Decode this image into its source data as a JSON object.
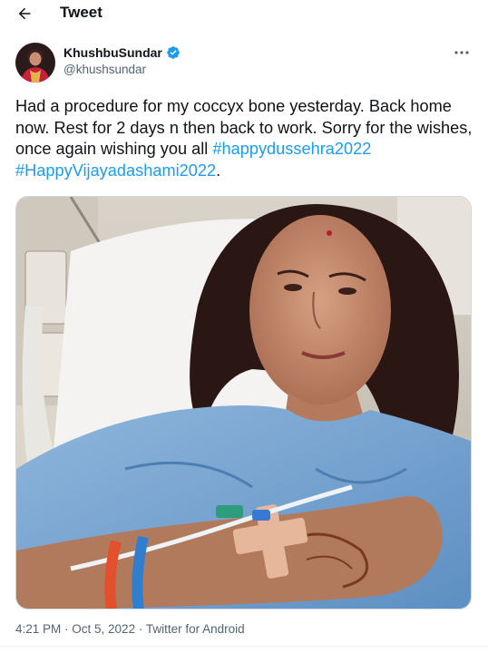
{
  "header": {
    "title": "Tweet",
    "back_icon": "arrow-left-icon"
  },
  "author": {
    "display_name": "KhushbuSundar",
    "handle": "@khushsundar",
    "verified": true,
    "verified_color": "#1d9bf0",
    "avatar_icon": "user-avatar"
  },
  "more_icon": "more-horizontal-icon",
  "tweet": {
    "text": "Had a procedure for my coccyx bone yesterday. Back home now. Rest for 2 days n then back to work. Sorry for the wishes, once again wishing you all ",
    "hashtags": [
      "#happydussehra2022",
      "#HappyVijayadashami2022"
    ],
    "hashtag_separator": " ",
    "trailing": ".",
    "media_description_icon": "photo-icon"
  },
  "meta": {
    "time": "4:21 PM",
    "date": "Oct 5, 2022",
    "separator": " · ",
    "source": "Twitter for Android"
  },
  "colors": {
    "link": "#1d9bf0",
    "secondary_text": "#536471",
    "primary_text": "#0f1419"
  }
}
